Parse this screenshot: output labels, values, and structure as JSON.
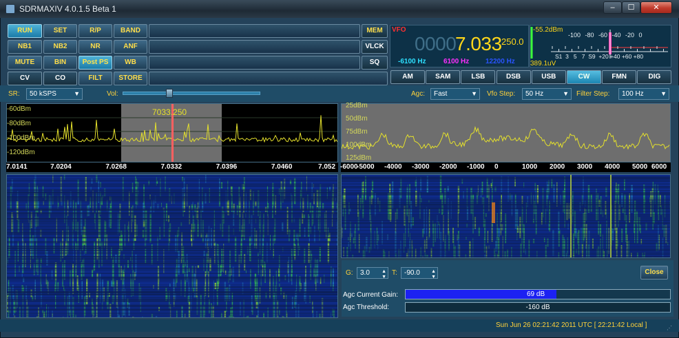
{
  "window": {
    "title": "SDRMAXIV 4.0.1.5 Beta 1",
    "min": "–",
    "max": "☐",
    "close": "✕"
  },
  "buttons": {
    "run": "RUN",
    "set": "SET",
    "rp": "R/P",
    "band": "BAND",
    "nb1": "NB1",
    "nb2": "NB2",
    "nr": "NR",
    "anf": "ANF",
    "mute": "MUTE",
    "bin": "BIN",
    "postps": "Post PS",
    "wb": "WB",
    "cv": "CV",
    "co": "CO",
    "filt": "FILT",
    "store": "STORE",
    "mem": "MEM",
    "vlck": "VLCK",
    "sq": "SQ"
  },
  "modes": [
    "AM",
    "SAM",
    "LSB",
    "DSB",
    "USB",
    "CW",
    "FMN",
    "DIG"
  ],
  "active_mode": "CW",
  "vfo": {
    "label": "VFO",
    "freq_dim": "0000",
    "freq_main": "7.033",
    "freq_sub": "250.0",
    "filter_low": "-6100 Hz",
    "filter_width": "6100 Hz",
    "filter_high": "12200 Hz"
  },
  "smeter": {
    "dbm": "-55.2dBm",
    "uv": "389.1uV",
    "scale_top": "-100 -80 -60 -40 -20 0",
    "scale_bottom": "S1  3   5   7  S9  +20 +40 +60 +80"
  },
  "controls": {
    "sr_label": "SR:",
    "sr_value": "50 kSPS",
    "vol_label": "Vol:",
    "vol_level": 0.34,
    "agc_label": "Agc:",
    "agc_value": "Fast",
    "vfostep_label": "Vfo Step:",
    "vfostep_value": "50 Hz",
    "filterstep_label": "Filter Step:",
    "filterstep_value": "100 Hz"
  },
  "spectrum_left": {
    "y_ticks": [
      "-60dBm",
      "-80dBm",
      "-100dBm",
      "-120dBm"
    ],
    "x_ticks": [
      "7.0141",
      "7.0204",
      "7.0268",
      "7.0332",
      "7.0396",
      "7.0460",
      "7.052"
    ],
    "marker_label": "7033.250"
  },
  "spectrum_right": {
    "y_ticks": [
      "25dBm",
      "50dBm",
      "75dBm",
      "100dBm",
      "125dBm"
    ],
    "x_ticks": [
      "-6000",
      "-5000",
      "-4000",
      "-3000",
      "-2000",
      "-1000",
      "0",
      "1000",
      "2000",
      "3000",
      "4000",
      "5000",
      "6000"
    ]
  },
  "agc_panel": {
    "g_label": "G:",
    "g_value": "3.0",
    "t_label": "T:",
    "t_value": "-90.0",
    "close_label": "Close",
    "gain_label": "Agc Current Gain:",
    "gain_value": "69 dB",
    "gain_fraction": 0.57,
    "threshold_label": "Agc Threshold:",
    "threshold_value": "-160 dB"
  },
  "status": {
    "text": "Sun Jun 26 02:21:42 2011 UTC  [ 22:21:42 Local ]"
  },
  "colors": {
    "bg": "#24425a",
    "accent": "#ffd23a",
    "spectrum": "#e4e02c",
    "marker": "#ff6060",
    "agc_fill": "#1c21f2"
  }
}
